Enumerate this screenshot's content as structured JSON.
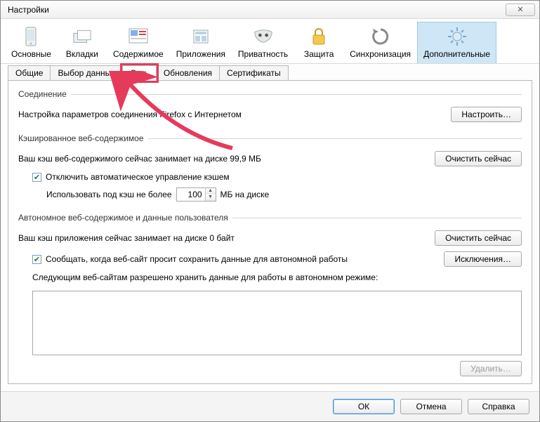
{
  "window": {
    "title": "Настройки",
    "close_glyph": "✕"
  },
  "toolbar": {
    "items": [
      {
        "label": "Основные"
      },
      {
        "label": "Вкладки"
      },
      {
        "label": "Содержимое"
      },
      {
        "label": "Приложения"
      },
      {
        "label": "Приватность"
      },
      {
        "label": "Защита"
      },
      {
        "label": "Синхронизация"
      },
      {
        "label": "Дополнительные"
      }
    ]
  },
  "subtabs": [
    {
      "label": "Общие"
    },
    {
      "label": "Выбор данных"
    },
    {
      "label": "Сеть"
    },
    {
      "label": "Обновления"
    },
    {
      "label": "Сертификаты"
    }
  ],
  "connection": {
    "heading": "Соединение",
    "description": "Настройка параметров соединения Firefox с Интернетом",
    "configure_btn": "Настроить…"
  },
  "cache": {
    "heading": "Кэшированное веб-содержимое",
    "usage_prefix": "Ваш кэш веб-содержимого сейчас занимает на диске ",
    "usage_value": "99,9 МБ",
    "clear_btn": "Очистить сейчас",
    "override_label": "Отключить автоматическое управление кэшем",
    "limit_prefix": "Использовать под кэш не более",
    "limit_value": "100",
    "limit_suffix": "МБ на диске"
  },
  "offline": {
    "heading": "Автономное веб-содержимое и данные пользователя",
    "usage": "Ваш кэш приложения сейчас занимает на диске 0 байт",
    "clear_btn": "Очистить сейчас",
    "notify_label": "Сообщать, когда веб-сайт просит сохранить данные для автономной работы",
    "exceptions_btn": "Исключения…",
    "list_label": "Следующим веб-сайтам разрешено хранить данные для работы в автономном режиме:",
    "remove_btn": "Удалить…"
  },
  "footer": {
    "ok": "ОК",
    "cancel": "Отмена",
    "help": "Справка"
  }
}
